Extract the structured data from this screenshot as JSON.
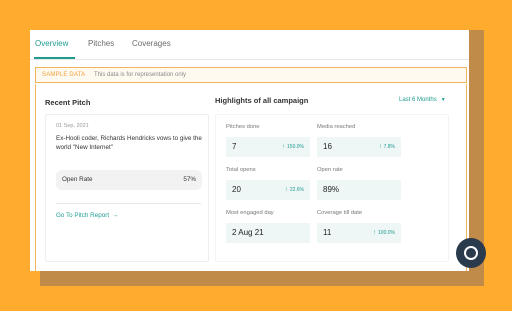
{
  "tabs": [
    {
      "label": "Overview",
      "active": true
    },
    {
      "label": "Pitches",
      "active": false
    },
    {
      "label": "Coverages",
      "active": false
    }
  ],
  "banner": {
    "tag": "SAMPLE DATA",
    "text": "This data is for representation only"
  },
  "recent_pitch": {
    "title": "Recent Pitch",
    "date": "01 Sep, 2021",
    "headline": "Ex-Hooli coder, Richards Hendricks vows to give the world \"New Internet\"",
    "open_rate_label": "Open Rate",
    "open_rate_value": "57%",
    "link_label": "Go To Pitch Report",
    "link_icon": "arrow-right-icon"
  },
  "highlights": {
    "title": "Highlights of all campaign",
    "range_label": "Last 6 Months",
    "range_icon": "caret-down-icon",
    "metrics": [
      {
        "label": "Pitches done",
        "value": "7",
        "trend": "150.0%"
      },
      {
        "label": "Media reached",
        "value": "16",
        "trend": "7.8%"
      },
      {
        "label": "Total opens",
        "value": "20",
        "trend": "22.6%"
      },
      {
        "label": "Open rate",
        "value": "89%",
        "trend": ""
      },
      {
        "label": "Most engaged day",
        "value": "2 Aug 21",
        "trend": ""
      },
      {
        "label": "Coverage till date",
        "value": "11",
        "trend": "100.0%"
      }
    ]
  },
  "colors": {
    "accent": "#1f9c8f",
    "background": "#FFAC2E",
    "sample_border": "#f2b45a"
  },
  "chat": {
    "icon": "chat-icon"
  }
}
